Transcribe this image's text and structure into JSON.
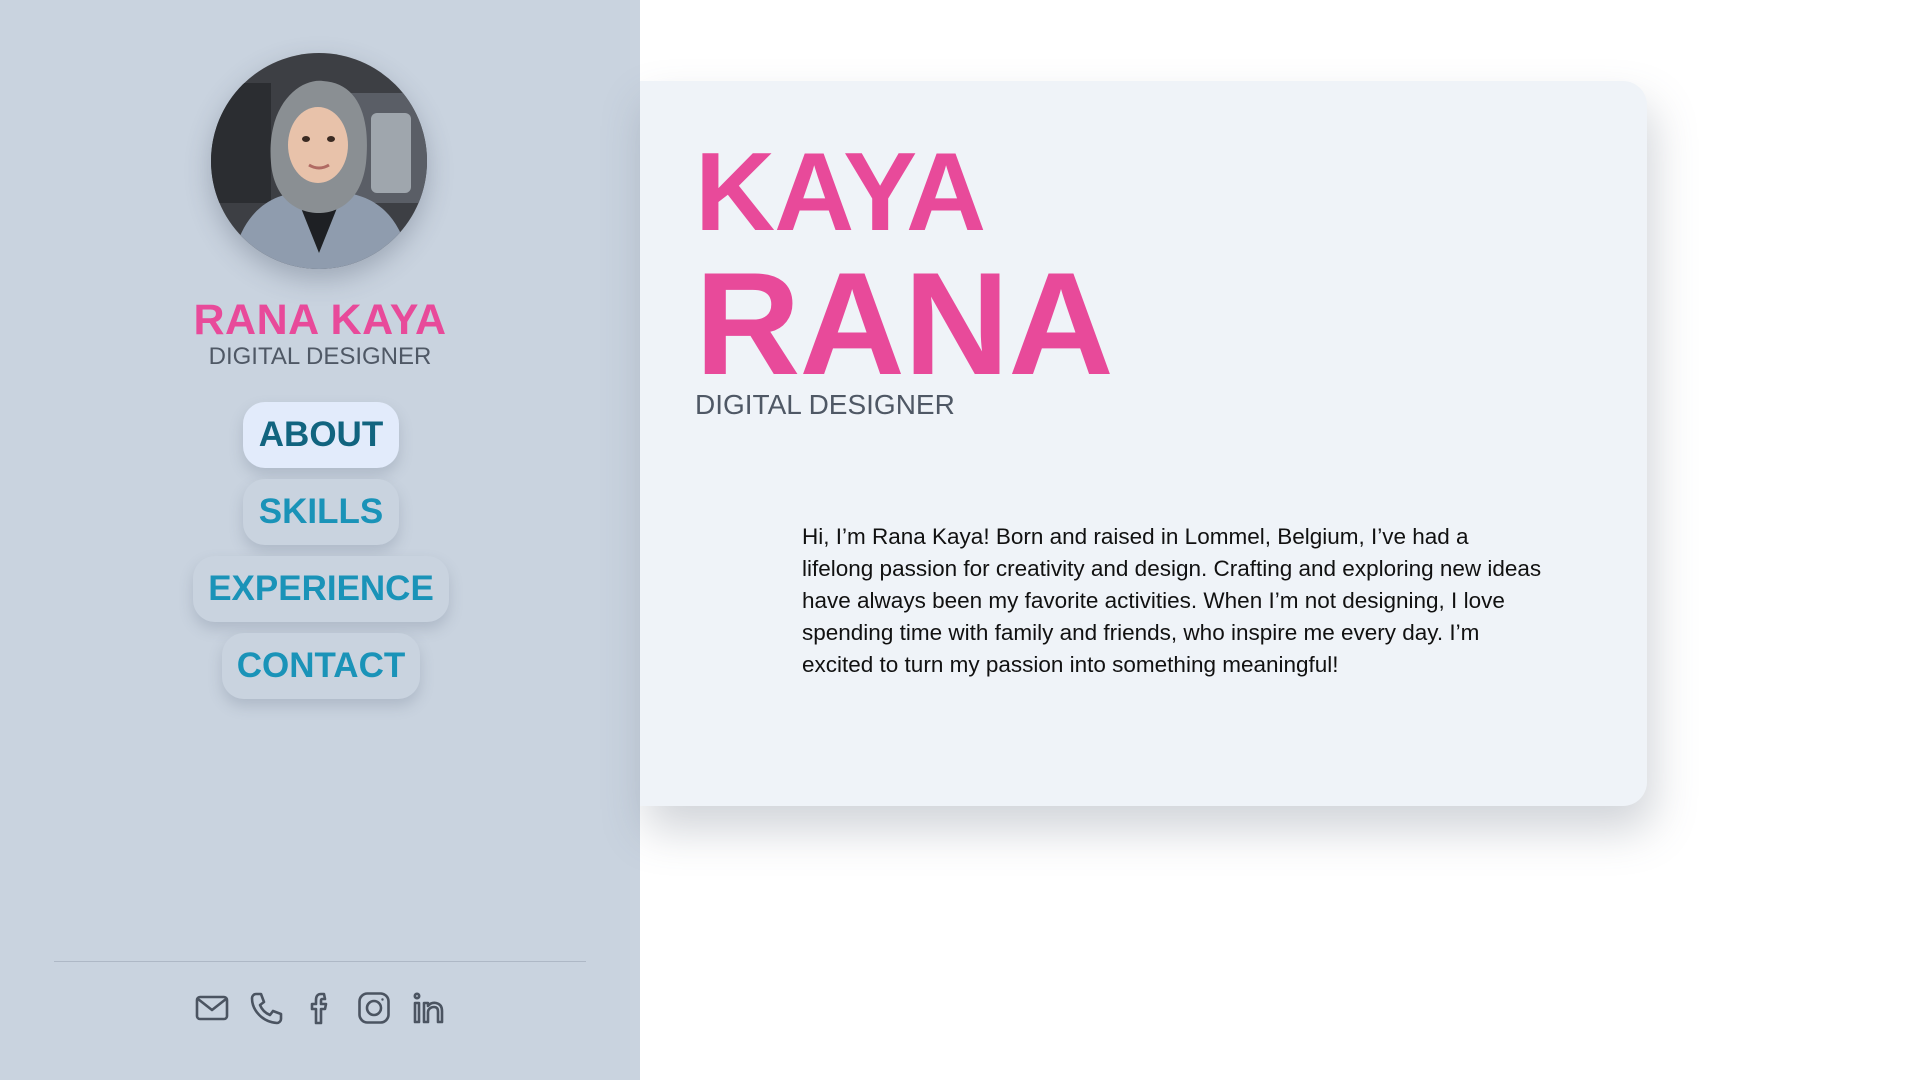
{
  "profile": {
    "name": "RANA KAYA",
    "role": "DIGITAL DESIGNER",
    "photo_alt": "profile-photo"
  },
  "nav": {
    "items": [
      {
        "label": "ABOUT",
        "active": true
      },
      {
        "label": "SKILLS",
        "active": false
      },
      {
        "label": "EXPERIENCE",
        "active": false
      },
      {
        "label": "CONTACT",
        "active": false
      }
    ]
  },
  "social": {
    "icons": [
      "mail-icon",
      "phone-icon",
      "facebook-icon",
      "instagram-icon",
      "linkedin-icon"
    ]
  },
  "hero": {
    "last_name": "KAYA",
    "first_name": "RANA",
    "role": "DIGITAL DESIGNER",
    "bio": "Hi, I’m Rana Kaya! Born and raised in Lommel, Belgium, I’ve had a lifelong passion for creativity and design. Crafting and exploring new ideas have always been my favorite activities. When I’m not designing, I love spending time with family and friends, who inspire me every day. I’m excited to turn my passion into something meaningful!"
  },
  "colors": {
    "accent_pink": "#e84a9a",
    "nav_blue": "#1a93b8",
    "sidebar_bg": "#c9d3df",
    "card_bg": "#eff3f8"
  }
}
